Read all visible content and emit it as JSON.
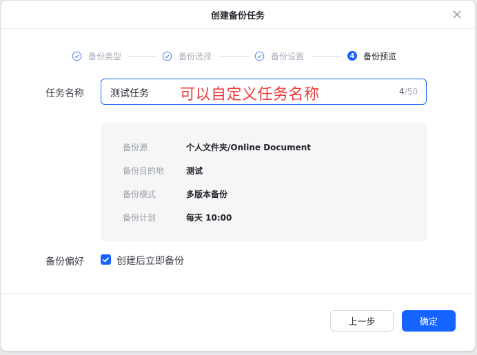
{
  "dialog": {
    "title": "创建备份任务"
  },
  "steps": [
    {
      "label": "备份类型",
      "state": "done"
    },
    {
      "label": "备份选择",
      "state": "done"
    },
    {
      "label": "备份设置",
      "state": "done"
    },
    {
      "label": "备份预览",
      "state": "active",
      "number": "4"
    }
  ],
  "form": {
    "name_label": "任务名称",
    "name_value": "测试任务",
    "name_annotation": "可以自定义任务名称",
    "count_current": "4",
    "count_max": "/50",
    "pref_label": "备份偏好",
    "pref_checkbox_label": "创建后立即备份",
    "pref_checked": true
  },
  "summary": [
    {
      "key": "备份源",
      "value": "个人文件夹/Online Document"
    },
    {
      "key": "备份目的地",
      "value": "测试"
    },
    {
      "key": "备份模式",
      "value": "多版本备份"
    },
    {
      "key": "备份计划",
      "value": "每天 10:00"
    }
  ],
  "buttons": {
    "prev": "上一步",
    "ok": "确定"
  },
  "colors": {
    "accent": "#1664ff",
    "annotation": "#ef3b3b"
  }
}
